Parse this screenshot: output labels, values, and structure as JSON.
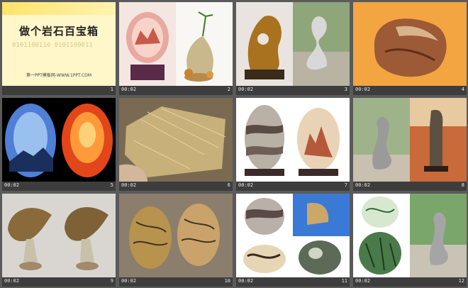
{
  "slides": [
    {
      "id": 1,
      "num": "1",
      "time": "",
      "title": "做个岩石百宝箱",
      "digits": "0101100110 0101100011",
      "site": "第一PPT模板网-WWW.1PPT.COM"
    },
    {
      "id": 2,
      "num": "2",
      "time": "00:02"
    },
    {
      "id": 3,
      "num": "3",
      "time": "00:02"
    },
    {
      "id": 4,
      "num": "4",
      "time": "00:02"
    },
    {
      "id": 5,
      "num": "5",
      "time": "00:02"
    },
    {
      "id": 6,
      "num": "6",
      "time": "00:02"
    },
    {
      "id": 7,
      "num": "7",
      "time": "00:02"
    },
    {
      "id": 8,
      "num": "8",
      "time": "00:02"
    },
    {
      "id": 9,
      "num": "9",
      "time": "00:02"
    },
    {
      "id": 10,
      "num": "10",
      "time": "00:02"
    },
    {
      "id": 11,
      "num": "11",
      "time": "00:02"
    },
    {
      "id": 12,
      "num": "12",
      "time": "00:02"
    }
  ]
}
